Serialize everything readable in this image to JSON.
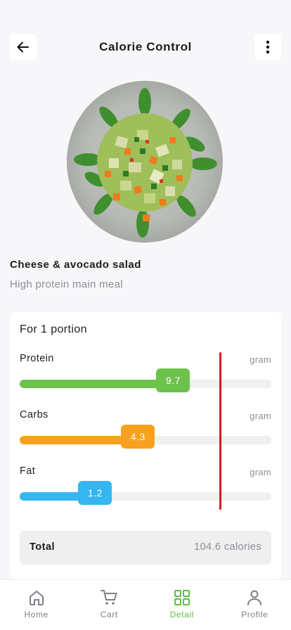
{
  "header": {
    "title": "Calorie Control",
    "back_icon": "arrow-left-icon",
    "more_icon": "more-vertical-icon"
  },
  "dish": {
    "name": "Cheese & avocado salad",
    "subtitle": "High protein main meal"
  },
  "nutrition": {
    "portion_label": "For 1 portion",
    "items": [
      {
        "label": "Protein",
        "unit": "gram",
        "value": "9.7",
        "fill_percent": 61,
        "color": "#6cc24a"
      },
      {
        "label": "Carbs",
        "unit": "gram",
        "value": "4.3",
        "fill_percent": 47,
        "color": "#f8a11f"
      },
      {
        "label": "Fat",
        "unit": "gram",
        "value": "1.2",
        "fill_percent": 30,
        "color": "#36b6f0"
      }
    ],
    "limit_line_color": "#d71d1d",
    "total": {
      "label": "Total",
      "value": "104.6 calories"
    }
  },
  "tabbar": {
    "active_color": "#5fbf3e",
    "tabs": [
      {
        "label": "Home",
        "icon": "home-icon",
        "active": false
      },
      {
        "label": "Cart",
        "icon": "cart-icon",
        "active": false
      },
      {
        "label": "Detail",
        "icon": "grid-icon",
        "active": true
      },
      {
        "label": "Profile",
        "icon": "user-icon",
        "active": false
      }
    ]
  }
}
